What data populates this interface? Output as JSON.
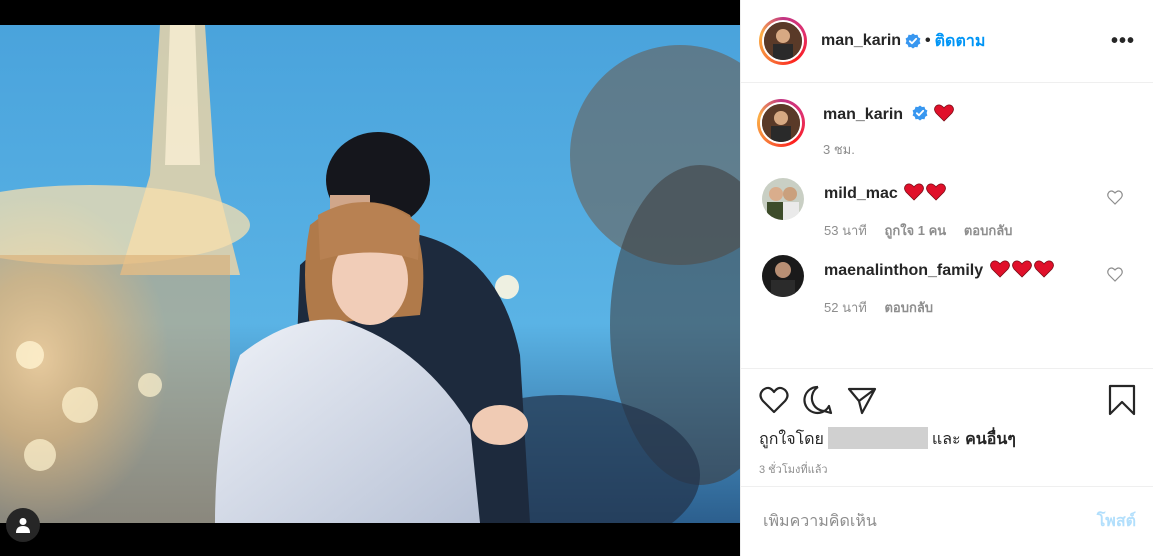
{
  "post": {
    "author": "man_karin",
    "follow_label": "ติดตาม",
    "dot": "•",
    "more": "•••"
  },
  "caption": {
    "username": "man_karin",
    "emoji": "red-heart",
    "time": "3 ชม."
  },
  "comments": [
    {
      "username": "mild_mac",
      "hearts": 2,
      "time": "53 นาที",
      "likes": "ถูกใจ 1 คน",
      "reply": "ตอบกลับ"
    },
    {
      "username": "maenalinthon_family",
      "hearts": 3,
      "time": "52 นาที",
      "reply": "ตอบกลับ"
    }
  ],
  "actions": {
    "liked_by_prefix": "ถูกใจโดย",
    "and": "และ",
    "others": "คนอื่นๆ",
    "timestamp": "3 ชั่วโมงที่แล้ว"
  },
  "add_comment": {
    "placeholder": "เพิ่มความคิดเห็น",
    "post_label": "โพสต์"
  },
  "colors": {
    "link_blue": "#0095f6",
    "post_disabled": "#b2dffc",
    "verified_blue": "#3897f0",
    "heart_red": "#e0102a"
  },
  "icons": [
    "user-tag-icon",
    "verified-icon",
    "more-icon",
    "heart-icon",
    "comment-icon",
    "share-icon",
    "bookmark-icon"
  ]
}
